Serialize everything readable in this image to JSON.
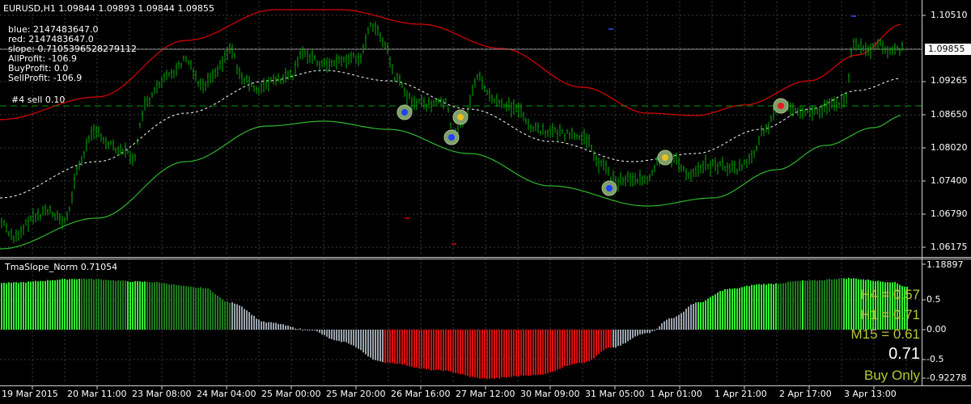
{
  "main": {
    "header": "EURUSD,H1  1.09844 1.09893 1.09844 1.09855",
    "info_lines": [
      "blue: 2147483647.0",
      "red: 2147483647.0",
      "slope: 0.7105396528279112",
      "AllProfit: -106.9",
      "BuyProfit: 0.0",
      "SellProfit: -106.9"
    ],
    "order_label": "#4 sell 0.10",
    "price_labels": [
      "1.10510",
      "1.09855",
      "1.09265",
      "1.08650",
      "1.08020",
      "1.07400",
      "1.06790",
      "1.06175"
    ],
    "current_price": "1.09855"
  },
  "indicator": {
    "title": "TmaSlope_Norm 0.71054",
    "scale_labels": [
      "1.18897",
      "0.5",
      "0.00",
      "-0.5",
      "-0.92278"
    ],
    "h4": "H4 = 0.57",
    "h1": "H1 = 0.71",
    "m15": "M15 = 0.61",
    "value": "0.71",
    "signal": "Buy Only"
  },
  "time_labels": [
    "19 Mar 2015",
    "20 Mar 11:00",
    "23 Mar 08:00",
    "24 Mar 04:00",
    "25 Mar 00:00",
    "25 Mar 20:00",
    "26 Mar 16:00",
    "27 Mar 12:00",
    "30 Mar 09:00",
    "31 Mar 05:00",
    "1 Apr 01:00",
    "1 Apr 21:00",
    "2 Apr 17:00",
    "3 Apr 13:00"
  ],
  "colors": {
    "background": "#000000",
    "grid": "#3a3a3a",
    "candles": "#00b000",
    "upper_band": "#e00000",
    "lower_band": "#2eb82e",
    "mid_line": "#ffffff",
    "order_line": "#009900",
    "hist_bright_green": "#33ee33",
    "hist_dark_green": "#1e7a1e",
    "hist_gray": "#9aa3ad",
    "hist_red": "#d81010",
    "panel_text": "#b8c832"
  }
}
